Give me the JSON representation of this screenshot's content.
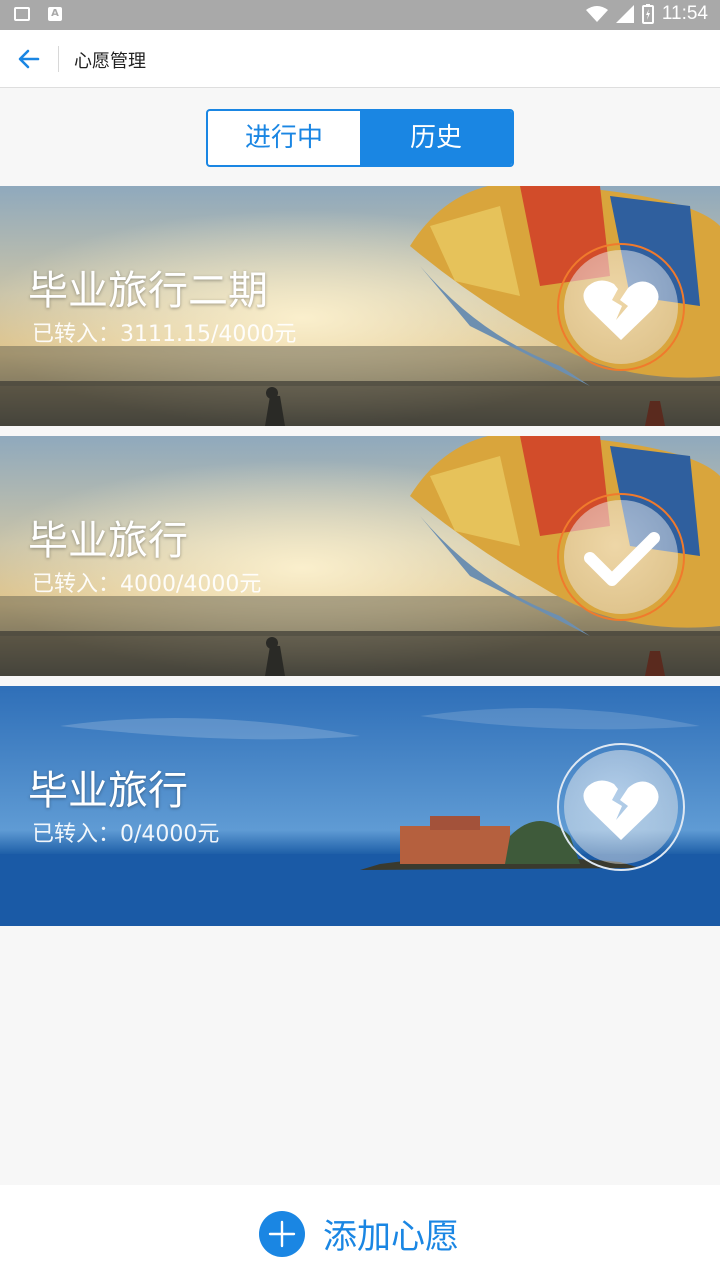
{
  "status_bar": {
    "time": "11:54"
  },
  "header": {
    "title": "心愿管理"
  },
  "tabs": [
    {
      "label": "进行中",
      "active": false
    },
    {
      "label": "历史",
      "active": true
    }
  ],
  "wishes": [
    {
      "title": "毕业旅行二期",
      "progress": "已转入：3111.15/4000元",
      "status_icon": "broken-heart-icon",
      "image": "parasail-beach"
    },
    {
      "title": "毕业旅行",
      "progress": "已转入：4000/4000元",
      "status_icon": "checkmark-icon",
      "image": "parasail-beach"
    },
    {
      "title": "毕业旅行",
      "progress": "已转入：0/4000元",
      "status_icon": "broken-heart-icon",
      "image": "island-sea"
    }
  ],
  "footer": {
    "add_label": "添加心愿"
  },
  "colors": {
    "accent": "#1a86e3",
    "badge_ring": "#f07a2c"
  }
}
